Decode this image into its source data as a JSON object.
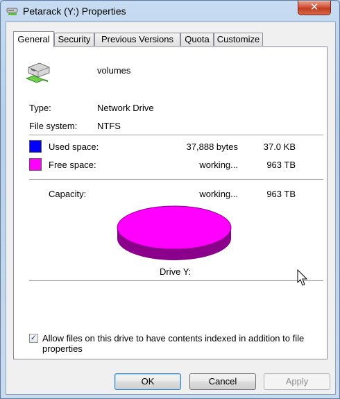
{
  "window": {
    "title": "Petarack (Y:) Properties",
    "close_glyph": "✕"
  },
  "tabs": [
    {
      "label": "General",
      "active": true
    },
    {
      "label": "Security",
      "active": false
    },
    {
      "label": "Previous Versions",
      "active": false
    },
    {
      "label": "Quota",
      "active": false
    },
    {
      "label": "Customize",
      "active": false
    }
  ],
  "general": {
    "volume_name": "volumes",
    "type_label": "Type:",
    "type_value": "Network Drive",
    "filesystem_label": "File system:",
    "filesystem_value": "NTFS",
    "used": {
      "label": "Used space:",
      "bytes": "37,888 bytes",
      "size": "37.0 KB",
      "color": "#0000ff"
    },
    "free": {
      "label": "Free space:",
      "bytes": "working...",
      "size": "963 TB",
      "color": "#ff00ff"
    },
    "capacity": {
      "label": "Capacity:",
      "bytes": "working...",
      "size": "963 TB"
    },
    "pie_top_color": "#ff00ff",
    "pie_side_color": "#8b008b",
    "drive_label": "Drive Y:",
    "index_checkbox": {
      "checked": true,
      "check_glyph": "✓",
      "line1": "Allow files on this drive to have contents indexed in addition to file",
      "line2": "properties"
    }
  },
  "buttons": {
    "ok": "OK",
    "cancel": "Cancel",
    "apply": "Apply"
  }
}
